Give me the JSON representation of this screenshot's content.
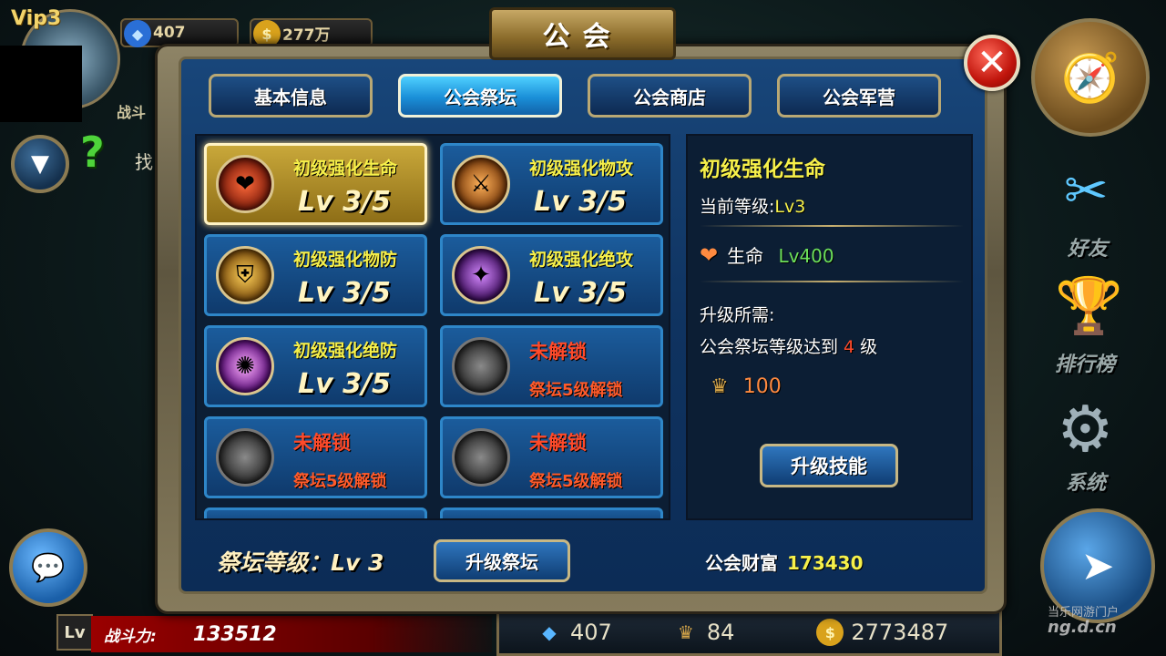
{
  "hud": {
    "vip": "Vip3",
    "diamonds": "407",
    "gold": "277万",
    "battle_power_label": "战斗力:",
    "battle_power_value": "133512",
    "partial_left_text": "找",
    "partial_left_label": "战斗",
    "lv_label": "Lv",
    "bottom_diamonds": "407",
    "bottom_badges": "84",
    "bottom_gold": "2773487"
  },
  "side_menu": {
    "friends": "好友",
    "ranking": "排行榜",
    "system": "系统"
  },
  "dialog": {
    "title": "公会",
    "close_icon": "close-x-icon",
    "tabs": [
      {
        "label": "基本信息",
        "active": false
      },
      {
        "label": "公会祭坛",
        "active": true
      },
      {
        "label": "公会商店",
        "active": false
      },
      {
        "label": "公会军营",
        "active": false
      }
    ],
    "skills": [
      {
        "name": "初级强化生命",
        "level": "Lv 3/5",
        "icon": "heart-icon",
        "selected": true,
        "locked": false
      },
      {
        "name": "初级强化物攻",
        "level": "Lv 3/5",
        "icon": "slash-attack-icon",
        "selected": false,
        "locked": false
      },
      {
        "name": "初级强化物防",
        "level": "Lv 3/5",
        "icon": "shield-icon",
        "selected": false,
        "locked": false
      },
      {
        "name": "初级强化绝攻",
        "level": "Lv 3/5",
        "icon": "magic-attack-icon",
        "selected": false,
        "locked": false
      },
      {
        "name": "初级强化绝防",
        "level": "Lv 3/5",
        "icon": "magic-defense-icon",
        "selected": false,
        "locked": false
      },
      {
        "name": "未解锁",
        "level": "祭坛5级解锁",
        "icon": "locked-orb-icon",
        "selected": false,
        "locked": true
      },
      {
        "name": "未解锁",
        "level": "祭坛5级解锁",
        "icon": "locked-orb-icon",
        "selected": false,
        "locked": true
      },
      {
        "name": "未解锁",
        "level": "祭坛5级解锁",
        "icon": "locked-orb-icon",
        "selected": false,
        "locked": true
      }
    ],
    "detail": {
      "title": "初级强化生命",
      "current_level_label": "当前等级:",
      "current_level_value": "Lv3",
      "stat_name": "生命",
      "stat_value": "Lv400",
      "requirement_label": "升级所需:",
      "requirement_text_before": "公会祭坛等级达到",
      "requirement_level": "4",
      "requirement_text_after": "级",
      "cost": "100",
      "upgrade_button": "升级技能"
    },
    "footer": {
      "altar_level_label": "祭坛等级：",
      "altar_level_value": "Lv 3",
      "upgrade_altar_button": "升级祭坛",
      "wealth_label": "公会财富",
      "wealth_value": "173430"
    }
  },
  "watermark": {
    "line1": "当乐网游门户",
    "line2": "ng.d.cn"
  },
  "colors": {
    "accent_yellow": "#f6f04a",
    "locked_red": "#ff4a2a",
    "panel_blue": "#0f3360",
    "tab_active": "#1a8fd8"
  }
}
